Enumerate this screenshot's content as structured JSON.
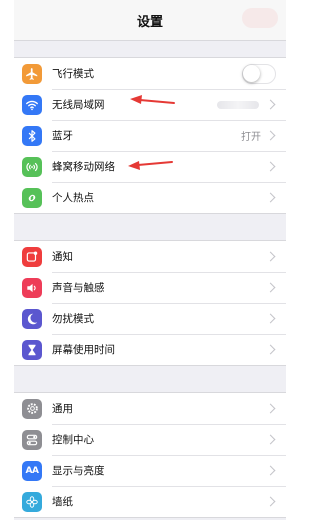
{
  "nav": {
    "title": "设置"
  },
  "groups": [
    {
      "items": [
        {
          "label": "飞行模式",
          "icon": "airplane-icon",
          "color": "#f29a38",
          "control": "toggle",
          "on": false
        },
        {
          "label": "无线局域网",
          "icon": "wifi-icon",
          "color": "#3478f6",
          "control": "chevron"
        },
        {
          "label": "蓝牙",
          "icon": "bluetooth-icon",
          "color": "#3478f6",
          "value": "打开",
          "control": "chevron"
        },
        {
          "label": "蜂窝移动网络",
          "icon": "cellular-icon",
          "color": "#56c158",
          "control": "chevron"
        },
        {
          "label": "个人热点",
          "icon": "hotspot-icon",
          "color": "#56c158",
          "control": "chevron"
        }
      ]
    },
    {
      "items": [
        {
          "label": "通知",
          "icon": "notification-icon",
          "color": "#ef3d3d",
          "control": "chevron"
        },
        {
          "label": "声音与触感",
          "icon": "sound-icon",
          "color": "#ee3c58",
          "control": "chevron"
        },
        {
          "label": "勿扰模式",
          "icon": "moon-icon",
          "color": "#5b57cf",
          "control": "chevron"
        },
        {
          "label": "屏幕使用时间",
          "icon": "hourglass-icon",
          "color": "#5b57cf",
          "control": "chevron"
        }
      ]
    },
    {
      "items": [
        {
          "label": "通用",
          "icon": "gear-icon",
          "color": "#8e8e93",
          "control": "chevron"
        },
        {
          "label": "控制中心",
          "icon": "control-center-icon",
          "color": "#8e8e93",
          "control": "chevron"
        },
        {
          "label": "显示与亮度",
          "icon": "display-icon",
          "color": "#3478f6",
          "control": "chevron"
        },
        {
          "label": "墙纸",
          "icon": "wallpaper-icon",
          "color": "#35aadc",
          "control": "chevron"
        }
      ]
    }
  ],
  "annotations": {
    "arrow_color": "#e53935"
  }
}
